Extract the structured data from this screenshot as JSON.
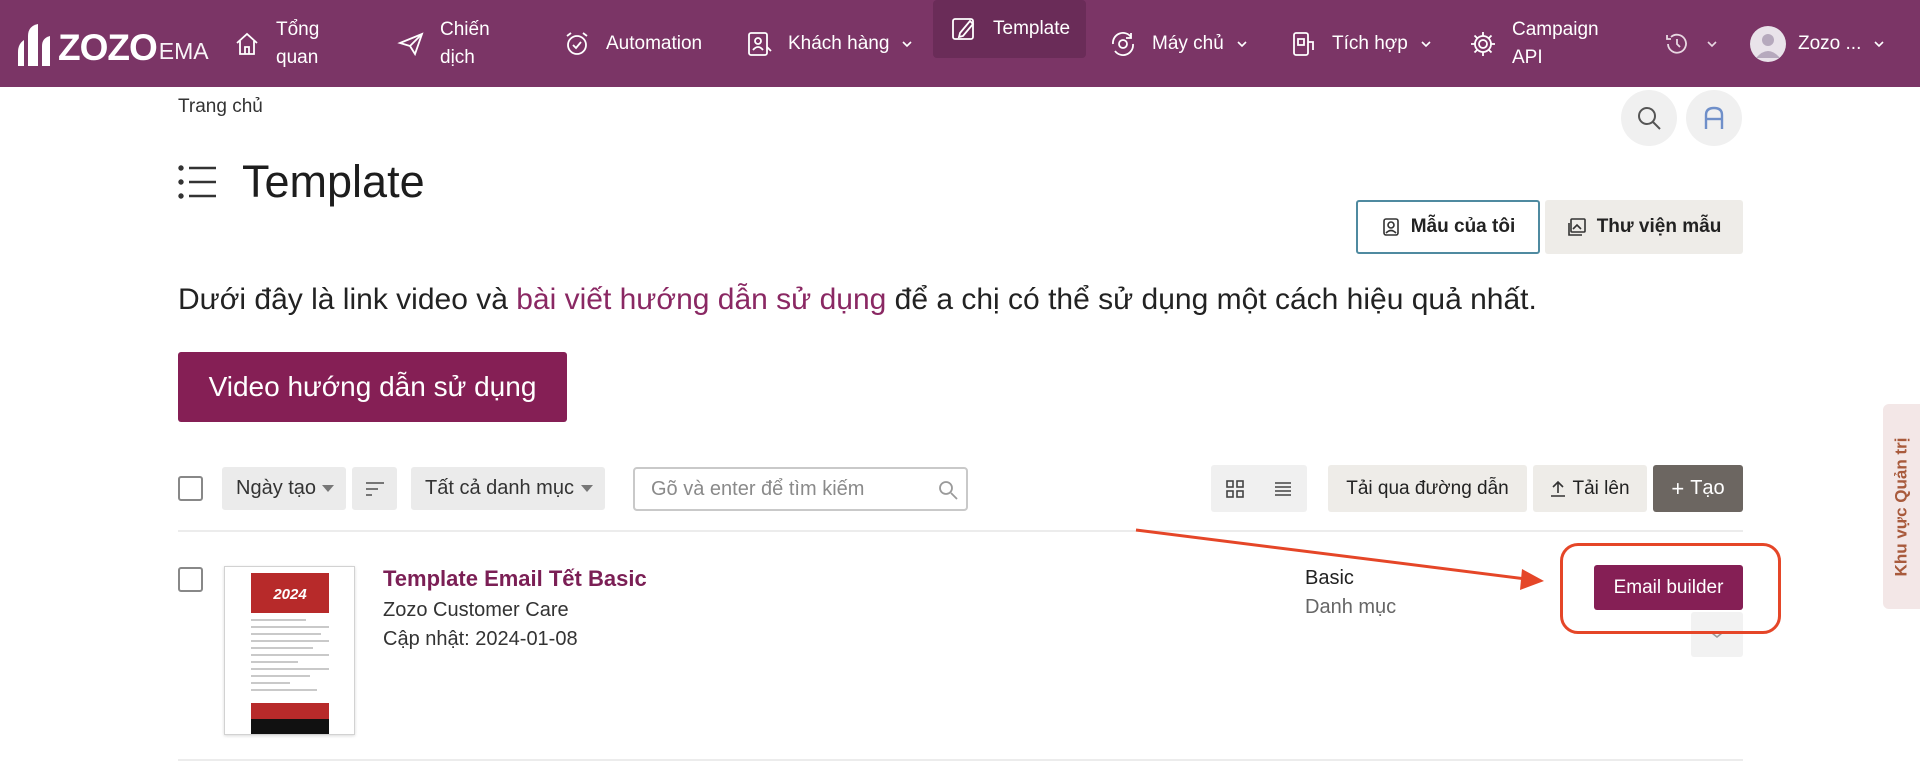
{
  "brand": {
    "logo_text": "ZOZO",
    "logo_sub": "EMA"
  },
  "nav": {
    "items": [
      {
        "label": "Tổng\nquan",
        "icon": "home-icon"
      },
      {
        "label": "Chiến\ndịch",
        "icon": "paper-plane-icon"
      },
      {
        "label": "Automation",
        "icon": "alarm-clock-icon"
      },
      {
        "label": "Khách hàng",
        "icon": "contacts-icon",
        "has_dropdown": true
      },
      {
        "label": "Template",
        "icon": "pen-square-icon",
        "active": true
      },
      {
        "label": "Máy chủ",
        "icon": "server-sync-icon",
        "has_dropdown": true
      },
      {
        "label": "Tích hợp",
        "icon": "integration-icon",
        "has_dropdown": true
      },
      {
        "label": "Campaign\nAPI",
        "icon": "gear-cog-icon"
      }
    ],
    "history_icon": "history-icon",
    "user": {
      "name": "Zozo ...",
      "avatar_icon": "user-avatar-icon"
    }
  },
  "breadcrumb": "Trang chủ",
  "header": {
    "title": "Template",
    "tabs": [
      {
        "label": "Mẫu của tôi",
        "icon": "portrait-icon",
        "active": true
      },
      {
        "label": "Thư viện mẫu",
        "icon": "image-gallery-icon"
      }
    ]
  },
  "intro": {
    "before": "Dưới đây là link video và ",
    "link": "bài viết hướng dẫn sử dụng",
    "after": " để a chị có thể sử dụng một cách hiệu quả nhất."
  },
  "video_button": "Video hướng dẫn sử dụng",
  "toolbar": {
    "sort_select": "Ngày tạo",
    "category_select": "Tất cả danh mục",
    "search_placeholder": "Gõ và enter để tìm kiếm",
    "import_link": "Tải qua đường dẫn",
    "upload": "Tải lên",
    "create": "Tạo"
  },
  "templates": [
    {
      "name": "Template Email Tết Basic",
      "author": "Zozo Customer Care",
      "updated": "Cập nhật: 2024-01-08",
      "category": "Basic",
      "category_label": "Danh mục",
      "action": "Email builder",
      "thumb_year": "2024"
    }
  ],
  "side_tab": "Khu vực Quản trị",
  "colors": {
    "nav_bg": "#7b3566",
    "primary": "#851f55",
    "annotation": "#e54628"
  }
}
